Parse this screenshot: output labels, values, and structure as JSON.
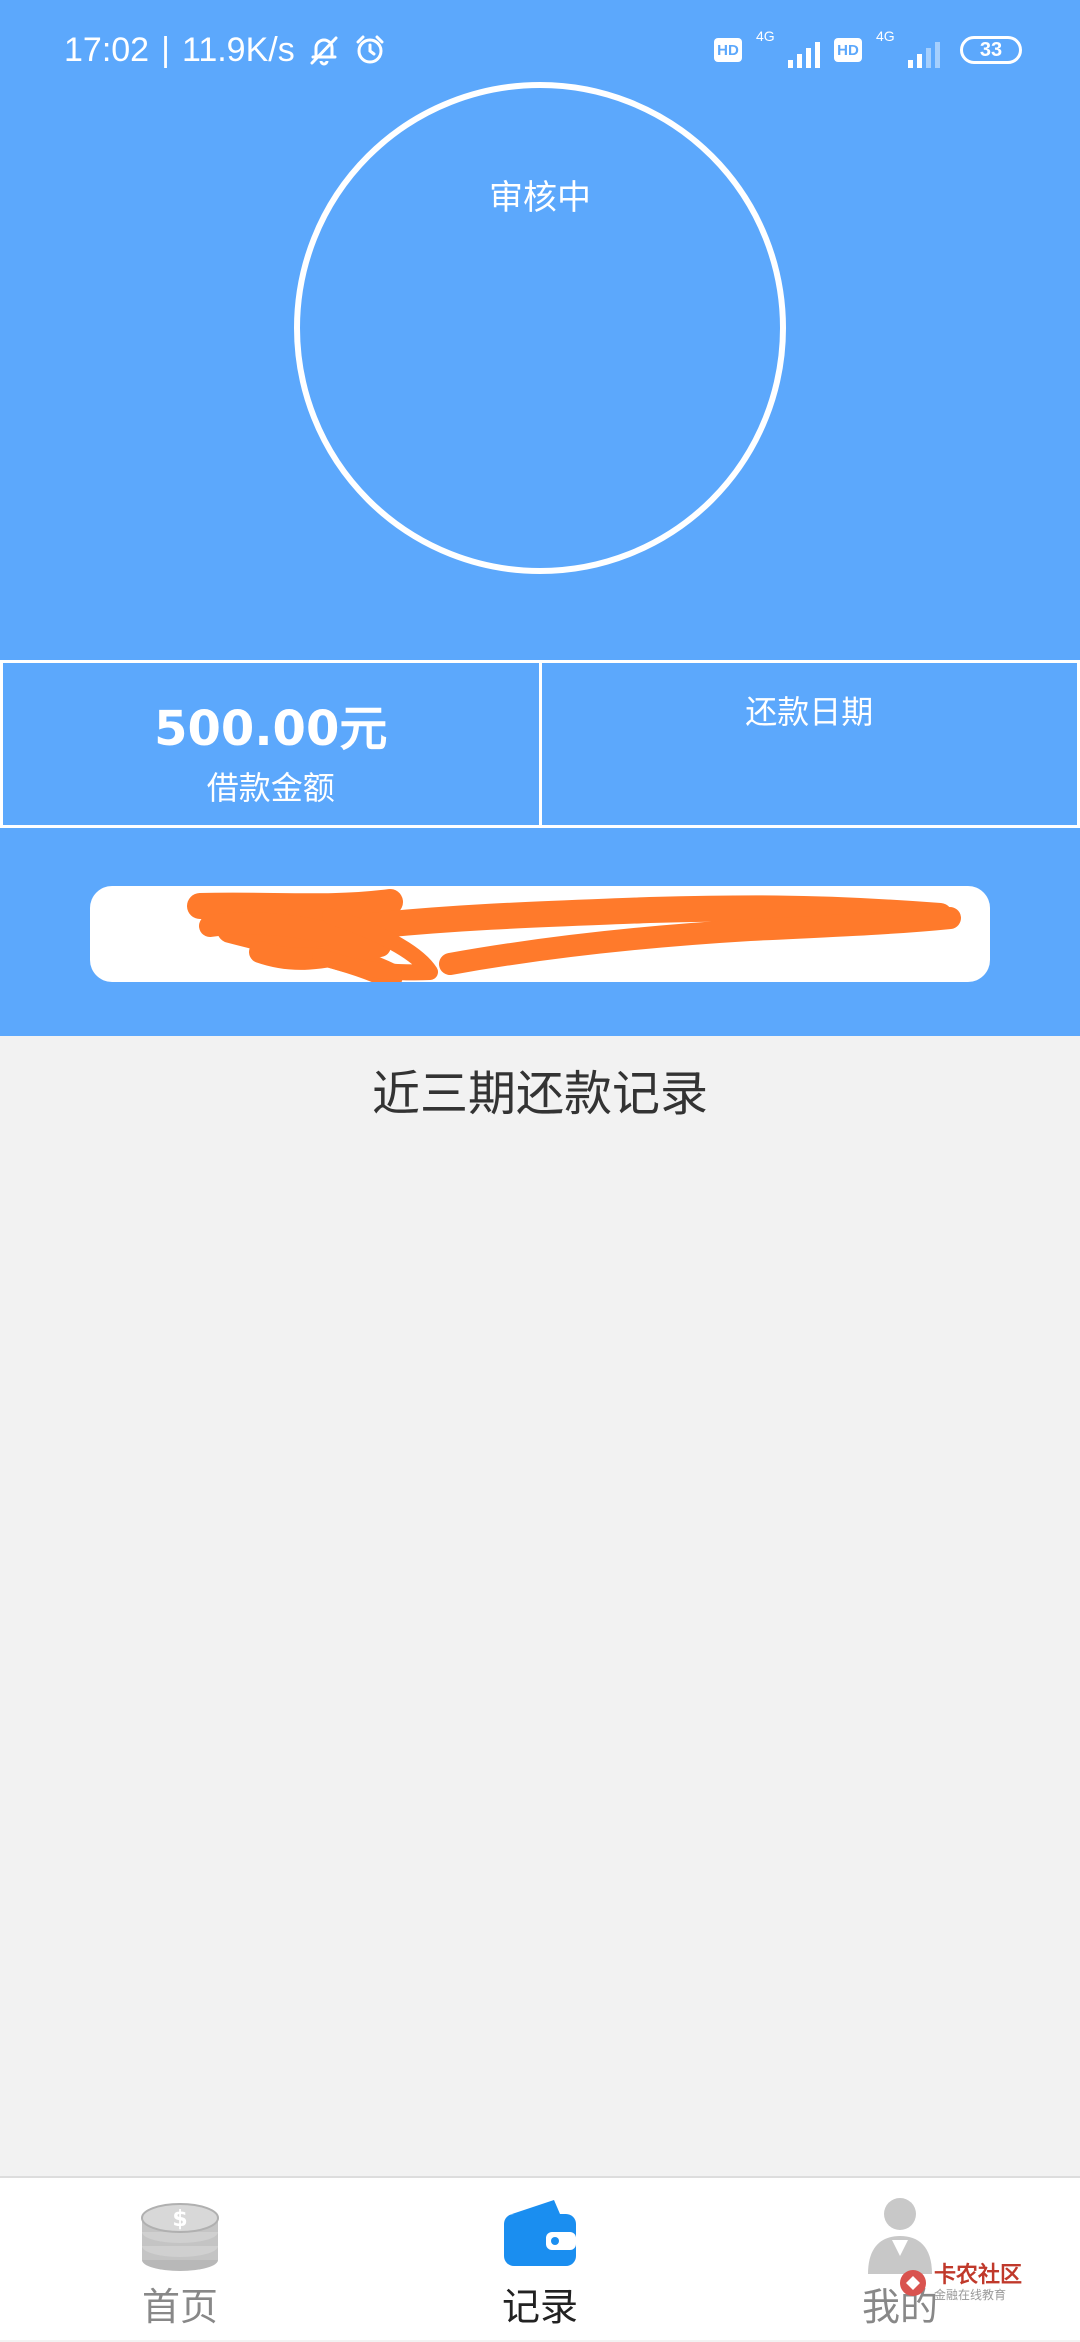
{
  "status_bar": {
    "time": "17:02",
    "separator": "|",
    "speed": "11.9K/s",
    "hd_label": "HD",
    "network_label": "4G",
    "battery": "33",
    "icons": [
      "mute-bell-icon",
      "alarm-clock-icon",
      "signal-icon",
      "battery-icon"
    ]
  },
  "hero": {
    "status_text": "审核中"
  },
  "loan": {
    "amount": "500.00元",
    "amount_label": "借款金额",
    "repay_date_label": "还款日期"
  },
  "card": {
    "masked_text": "",
    "redaction_color": "#ff7a2b"
  },
  "records": {
    "title": "近三期还款记录"
  },
  "tabbar": {
    "tabs": [
      {
        "label": "首页",
        "icon": "coins-icon",
        "active": false
      },
      {
        "label": "记录",
        "icon": "wallet-icon",
        "active": true
      },
      {
        "label": "我的",
        "icon": "user-icon",
        "active": false
      }
    ]
  },
  "watermark": {
    "title": "卡农社区",
    "subtitle": "金融在线教育"
  },
  "colors": {
    "primary": "#5ca8fc",
    "background": "#f2f2f2",
    "tab_active": "#1a8ef0",
    "tab_inactive": "#b8b8b8"
  }
}
